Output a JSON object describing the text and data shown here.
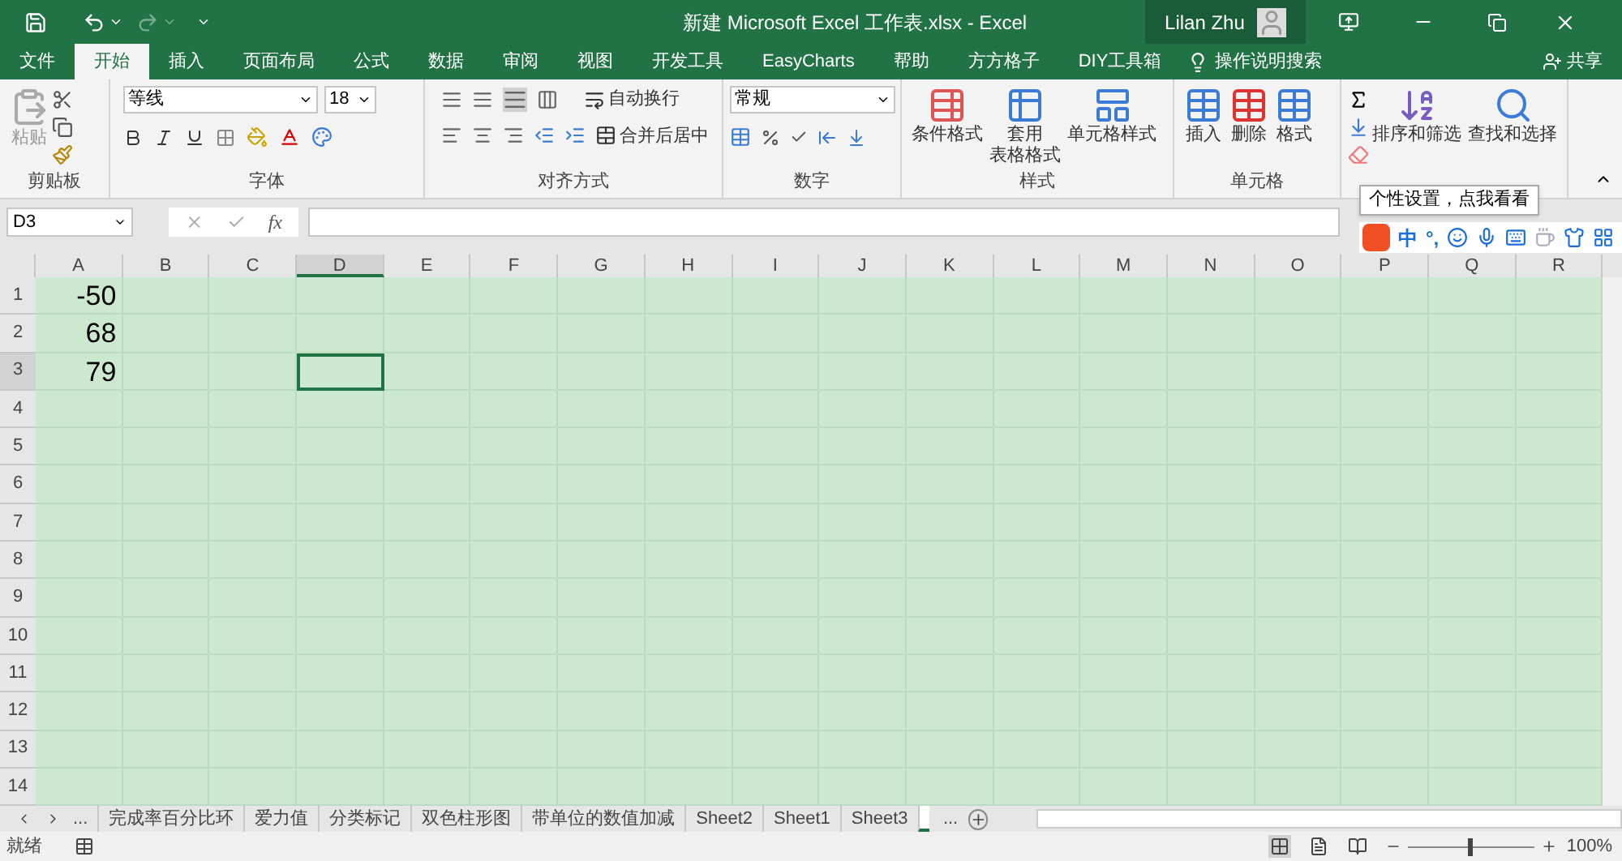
{
  "title_bar": {
    "title": "新建 Microsoft Excel 工作表.xlsx  -  Excel",
    "user_name": "Lilan Zhu"
  },
  "ribbon_tabs": [
    {
      "label": "文件",
      "selected": false
    },
    {
      "label": "开始",
      "selected": true
    },
    {
      "label": "插入",
      "selected": false
    },
    {
      "label": "页面布局",
      "selected": false
    },
    {
      "label": "公式",
      "selected": false
    },
    {
      "label": "数据",
      "selected": false
    },
    {
      "label": "审阅",
      "selected": false
    },
    {
      "label": "视图",
      "selected": false
    },
    {
      "label": "开发工具",
      "selected": false
    },
    {
      "label": "EasyCharts",
      "selected": false
    },
    {
      "label": "帮助",
      "selected": false
    },
    {
      "label": "方方格子",
      "selected": false
    },
    {
      "label": "DIY工具箱",
      "selected": false
    }
  ],
  "tell_me": "操作说明搜索",
  "share": "共享",
  "clipboard": {
    "paste": "粘贴",
    "label": "剪贴板"
  },
  "font": {
    "name": "等线",
    "size": "18",
    "label": "字体"
  },
  "alignment": {
    "wrap": "自动换行",
    "merge": "合并后居中",
    "label": "对齐方式"
  },
  "number": {
    "format": "常规",
    "label": "数字"
  },
  "styles": {
    "conditional": "条件格式",
    "table_line1": "套用",
    "table_line2": "表格格式",
    "cell_styles": "单元格样式",
    "label": "样式"
  },
  "cells": {
    "insert": "插入",
    "delete": "删除",
    "format": "格式",
    "label": "单元格"
  },
  "editing": {
    "sort": "排序和筛选",
    "find": "查找和选择"
  },
  "tooltip": "个性设置，点我看看",
  "ime": {
    "mode": "中",
    "punct": "°,"
  },
  "formula_bar": {
    "name_box": "D3",
    "fx": "fx"
  },
  "columns": [
    {
      "label": "A",
      "selected": false
    },
    {
      "label": "B",
      "selected": false
    },
    {
      "label": "C",
      "selected": false
    },
    {
      "label": "D",
      "selected": true
    },
    {
      "label": "E",
      "selected": false
    },
    {
      "label": "F",
      "selected": false
    },
    {
      "label": "G",
      "selected": false
    },
    {
      "label": "H",
      "selected": false
    },
    {
      "label": "I",
      "selected": false
    },
    {
      "label": "J",
      "selected": false
    },
    {
      "label": "K",
      "selected": false
    },
    {
      "label": "L",
      "selected": false
    },
    {
      "label": "M",
      "selected": false
    },
    {
      "label": "N",
      "selected": false
    },
    {
      "label": "O",
      "selected": false
    },
    {
      "label": "P",
      "selected": false
    },
    {
      "label": "Q",
      "selected": false
    },
    {
      "label": "R",
      "selected": false
    }
  ],
  "rows": [
    {
      "header": "1",
      "selected": false,
      "cells": [
        "-50"
      ]
    },
    {
      "header": "2",
      "selected": false,
      "cells": [
        "68"
      ]
    },
    {
      "header": "3",
      "selected": true,
      "cells": [
        "79"
      ]
    },
    {
      "header": "4",
      "selected": false,
      "cells": []
    },
    {
      "header": "5",
      "selected": false,
      "cells": []
    },
    {
      "header": "6",
      "selected": false,
      "cells": []
    },
    {
      "header": "7",
      "selected": false,
      "cells": []
    },
    {
      "header": "8",
      "selected": false,
      "cells": []
    },
    {
      "header": "9",
      "selected": false,
      "cells": []
    },
    {
      "header": "10",
      "selected": false,
      "cells": []
    },
    {
      "header": "11",
      "selected": false,
      "cells": []
    },
    {
      "header": "12",
      "selected": false,
      "cells": []
    },
    {
      "header": "13",
      "selected": false,
      "cells": []
    },
    {
      "header": "14",
      "selected": false,
      "cells": []
    }
  ],
  "sheet_nav": {
    "more_left": "...",
    "more_right": "..."
  },
  "sheet_tabs": [
    {
      "label": "完成率百分比环",
      "selected": false
    },
    {
      "label": "爱力值",
      "selected": false
    },
    {
      "label": "分类标记",
      "selected": false
    },
    {
      "label": "双色柱形图",
      "selected": false
    },
    {
      "label": "带单位的数值加减",
      "selected": false
    },
    {
      "label": "Sheet2",
      "selected": false
    },
    {
      "label": "Sheet1",
      "selected": false
    },
    {
      "label": "Sheet3",
      "selected": false
    },
    {
      "selected": true
    }
  ],
  "status": {
    "text": "就绪",
    "zoom": "100%",
    "zoom_slider": {
      "level": 0.5
    },
    "view_buttons": [
      {
        "kind": "normal",
        "selected": true
      },
      {
        "kind": "layout",
        "selected": false
      },
      {
        "kind": "break",
        "selected": false
      }
    ]
  }
}
